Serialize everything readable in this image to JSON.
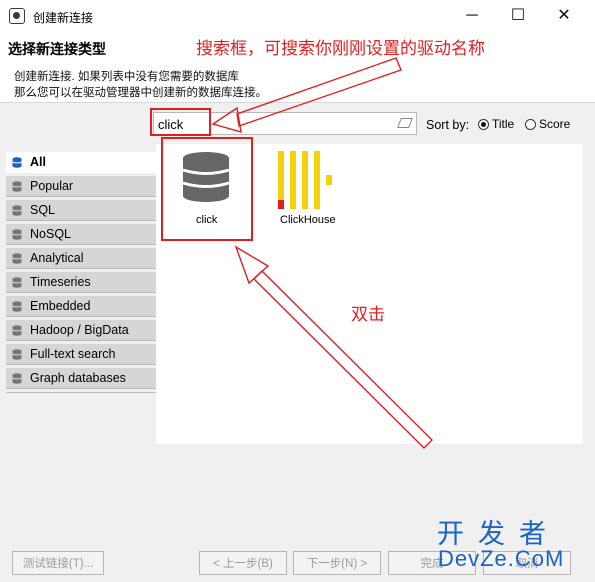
{
  "window": {
    "title": "创建新连接",
    "minimize_label": "─",
    "maximize_label": "☐",
    "close_label": "✕"
  },
  "header": {
    "title": "选择新连接类型",
    "description_line1": "创建新连接. 如果列表中没有您需要的数据库",
    "description_line2": "那么您可以在驱动管理器中创建新的数据库连接。"
  },
  "annotations": {
    "search_note": "搜索框，可搜索你刚刚设置的驱动名称",
    "double_click_note": "双击",
    "color": "#e02020"
  },
  "search": {
    "value": "click"
  },
  "sort": {
    "label": "Sort by:",
    "options": [
      "Title",
      "Score"
    ],
    "selected": "Title"
  },
  "categories": [
    {
      "label": "All",
      "icon": "database-stack-icon",
      "active": true
    },
    {
      "label": "Popular",
      "icon": "database-icon"
    },
    {
      "label": "SQL",
      "icon": "database-icon"
    },
    {
      "label": "NoSQL",
      "icon": "database-icon"
    },
    {
      "label": "Analytical",
      "icon": "database-icon"
    },
    {
      "label": "Timeseries",
      "icon": "database-icon"
    },
    {
      "label": "Embedded",
      "icon": "database-icon"
    },
    {
      "label": "Hadoop / BigData",
      "icon": "database-icon"
    },
    {
      "label": "Full-text search",
      "icon": "database-icon"
    },
    {
      "label": "Graph databases",
      "icon": "database-icon"
    }
  ],
  "drivers": [
    {
      "label": "click",
      "icon": "database-cylinder-icon"
    },
    {
      "label": "ClickHouse",
      "icon": "clickhouse-logo-icon"
    }
  ],
  "buttons": {
    "test": "测试链接(T)...",
    "back": "< 上一步(B)",
    "next": "下一步(N) >",
    "finish": "完成",
    "cancel": "取消"
  },
  "watermark": {
    "line1": "开发者",
    "line2": "DevZe.CoM",
    "color": "#1c63c6"
  }
}
